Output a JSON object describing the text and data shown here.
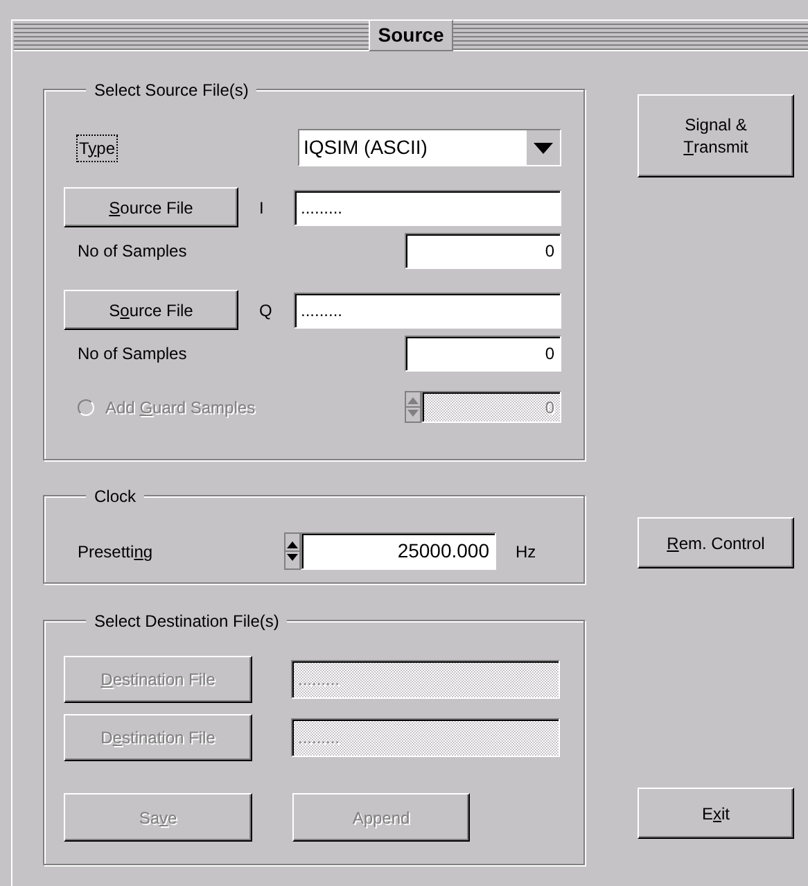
{
  "title": "Source",
  "source_group": {
    "legend": "Select Source File(s)",
    "type": {
      "label": {
        "pre": "T",
        "key": "y",
        "post": "pe"
      },
      "focused": true,
      "value": "IQSIM (ASCII)"
    },
    "files": [
      {
        "button": {
          "key": "S",
          "post": "ource File"
        },
        "channel": "I",
        "path": ".........",
        "samples_label": "No of Samples",
        "samples": "0"
      },
      {
        "button": {
          "pre": "S",
          "key": "o",
          "post": "urce File"
        },
        "channel": "Q",
        "path": ".........",
        "samples_label": "No of Samples",
        "samples": "0"
      }
    ],
    "guard": {
      "label": {
        "pre": "Add ",
        "key": "G",
        "post": "uard Samples"
      },
      "checked": false,
      "enabled": false,
      "value": "0"
    }
  },
  "clock": {
    "legend": "Clock",
    "label": {
      "pre": "Presetti",
      "key": "n",
      "post": "g"
    },
    "value": "25000.000",
    "unit": "Hz"
  },
  "destination": {
    "legend": "Select Destination  File(s)",
    "enabled": false,
    "files": [
      {
        "button": {
          "key": "D",
          "post": "estination File"
        },
        "path": "........."
      },
      {
        "button": {
          "pre": "D",
          "key": "e",
          "post": "stination File"
        },
        "path": "........."
      }
    ],
    "buttons": [
      {
        "label": {
          "pre": "Sa",
          "key": "v",
          "post": "e"
        }
      },
      {
        "label": {
          "pre": "Append"
        }
      }
    ]
  },
  "side_buttons": [
    {
      "label": {
        "pre": "Signal & ",
        "key": "T",
        "post": "ransmit"
      }
    },
    {
      "label": {
        "key": "R",
        "post": "em. Control"
      }
    },
    {
      "label": {
        "pre": "E",
        "key": "x",
        "post": "it"
      }
    }
  ]
}
